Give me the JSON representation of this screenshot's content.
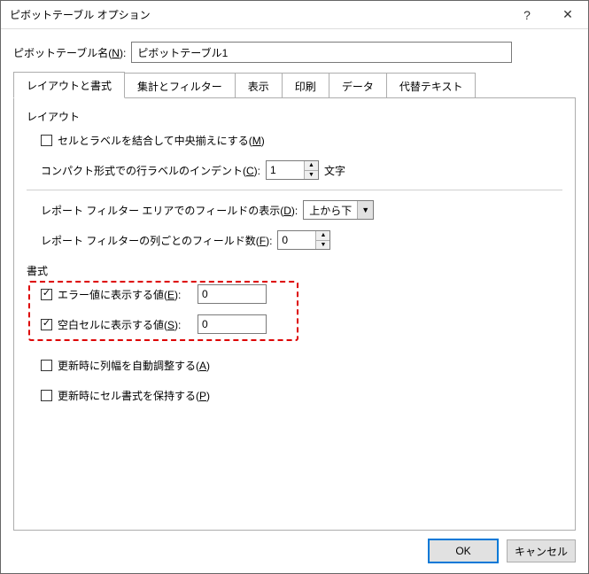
{
  "title": "ピボットテーブル オプション",
  "name_label_pre": "ピボットテーブル名(",
  "name_label_u": "N",
  "name_label_post": "):",
  "name_value": "ピボットテーブル1",
  "tabs": {
    "layout": "レイアウトと書式",
    "totals": "集計とフィルター",
    "display": "表示",
    "print": "印刷",
    "data": "データ",
    "alt": "代替テキスト"
  },
  "section_layout": "レイアウト",
  "merge_pre": "セルとラベルを結合して中央揃えにする(",
  "merge_u": "M",
  "merge_post": ")",
  "indent_pre": "コンパクト形式での行ラベルのインデント(",
  "indent_u": "C",
  "indent_post": "):",
  "indent_value": "1",
  "indent_suffix": "文字",
  "rf_area_pre": "レポート フィルター エリアでのフィールドの表示(",
  "rf_area_u": "D",
  "rf_area_post": "):",
  "rf_area_value": "上から下",
  "rf_cols_pre": "レポート フィルターの列ごとのフィールド数(",
  "rf_cols_u": "F",
  "rf_cols_post": "):",
  "rf_cols_value": "0",
  "section_format": "書式",
  "err_pre": "エラー値に表示する値(",
  "err_u": "E",
  "err_post": "):",
  "err_value": "0",
  "empty_pre": "空白セルに表示する値(",
  "empty_u": "S",
  "empty_post": "):",
  "empty_value": "0",
  "autofit_pre": "更新時に列幅を自動調整する(",
  "autofit_u": "A",
  "autofit_post": ")",
  "preserve_pre": "更新時にセル書式を保持する(",
  "preserve_u": "P",
  "preserve_post": ")",
  "ok": "OK",
  "cancel": "キャンセル"
}
